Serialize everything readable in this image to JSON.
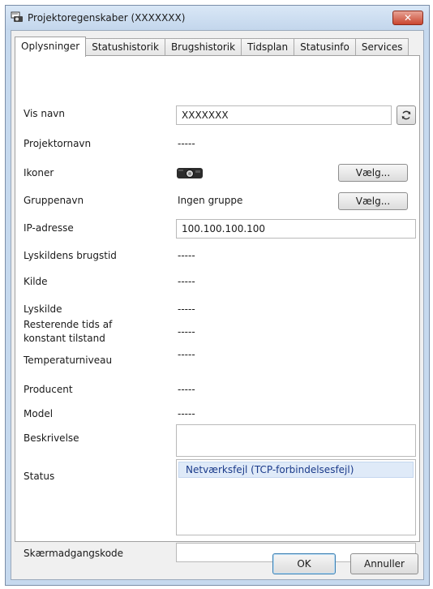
{
  "window": {
    "title": "Projektoregenskaber (XXXXXXX)",
    "close_label": "✕"
  },
  "tabs": [
    {
      "label": "Oplysninger",
      "active": true
    },
    {
      "label": "Statushistorik"
    },
    {
      "label": "Brugshistorik"
    },
    {
      "label": "Tidsplan"
    },
    {
      "label": "Statusinfo"
    },
    {
      "label": "Services"
    }
  ],
  "form": {
    "display_name": {
      "label": "Vis navn",
      "value": "XXXXXXX"
    },
    "projector_name": {
      "label": "Projektornavn",
      "value": "-----"
    },
    "icons": {
      "label": "Ikoner",
      "button": "Vælg..."
    },
    "group_name": {
      "label": "Gruppenavn",
      "value": "Ingen gruppe",
      "button": "Vælg..."
    },
    "ip_address": {
      "label": "IP-adresse",
      "value": "100.100.100.100"
    },
    "light_source_usage": {
      "label": "Lyskildens brugstid",
      "value": "-----"
    },
    "source": {
      "label": "Kilde",
      "value": "-----"
    },
    "light_source": {
      "label": "Lyskilde",
      "value": "-----"
    },
    "remaining_time": {
      "label_line1": "Resterende tids af",
      "label_line2": "konstant tilstand",
      "value": "-----"
    },
    "temperature": {
      "label": "Temperaturniveau"
    },
    "manufacturer": {
      "label": "Producent",
      "value": "-----"
    },
    "model": {
      "label": "Model",
      "value": "-----"
    },
    "description": {
      "label": "Beskrivelse",
      "value": ""
    },
    "status": {
      "label": "Status",
      "items": [
        "Netværksfejl (TCP-forbindelsesfejl)"
      ]
    },
    "screen_password": {
      "label": "Skærmadgangskode",
      "value": ""
    }
  },
  "footer": {
    "ok_label": "OK",
    "cancel_label": "Annuller"
  },
  "colors": {
    "window_frame": "#c6d9ee",
    "status_highlight": "#dfeaf8",
    "close_button": "#c9452f"
  },
  "icons": {
    "app": "projector-app-icon",
    "refresh": "refresh-icon",
    "projector": "projector-icon"
  }
}
